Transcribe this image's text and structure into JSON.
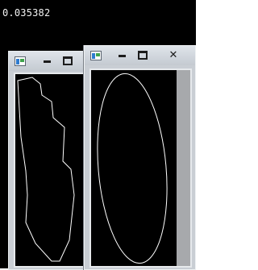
{
  "console": {
    "readout": "0.035382",
    "background": "#000000",
    "text_color": "#f2f2f2"
  },
  "windows": [
    {
      "name": "contour-window",
      "icon": "app-icon",
      "buttons": [
        {
          "name": "minimize-button",
          "icon": "minimize-icon"
        },
        {
          "name": "maximize-button",
          "icon": "maximize-icon"
        }
      ],
      "shape": "polygon-contour",
      "stroke": "#ffffff"
    },
    {
      "name": "ellipse-window",
      "icon": "app-icon",
      "buttons": [
        {
          "name": "minimize-button",
          "icon": "minimize-icon"
        },
        {
          "name": "maximize-button",
          "icon": "maximize-icon"
        },
        {
          "name": "close-button",
          "icon": "close-icon",
          "glyph": "✕"
        }
      ],
      "shape": "fitted-ellipse",
      "stroke": "#ffffff"
    }
  ]
}
